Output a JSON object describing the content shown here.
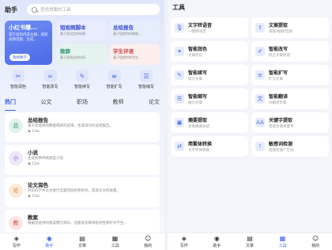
{
  "left": {
    "title": "助手",
    "search_placeholder": "查找想要的工具",
    "hero": {
      "big": {
        "title": "小红书爆...",
        "desc": "基于您的内容主题，提取高频话题，生成...",
        "button": "我想教学"
      },
      "cards": [
        {
          "title": "短视频脚本",
          "desc": "基于您设定的场景..."
        },
        {
          "title": "总结报告",
          "desc": "基于您提供的数据..."
        },
        {
          "title": "致辞",
          "desc": "基于您给出的时间..."
        },
        {
          "title": "学生评语",
          "desc": "基于您提供的学生..."
        }
      ]
    },
    "quick_tools": [
      {
        "icon": "scissors-icon",
        "glyph": "✂",
        "label": "智能润色"
      },
      {
        "icon": "link-icon",
        "glyph": "∞",
        "label": "智能改写"
      },
      {
        "icon": "pen-icon",
        "glyph": "✎",
        "label": "智能续写"
      },
      {
        "icon": "list-icon",
        "glyph": "≡",
        "label": "智能扩写"
      },
      {
        "icon": "compress-icon",
        "glyph": "☰",
        "label": "智能缩写"
      }
    ],
    "tabs": [
      "热门",
      "公文",
      "职场",
      "教师",
      "论文"
    ],
    "active_tab": 0,
    "items": [
      {
        "avatar": "总",
        "color": "#dff1ee",
        "fg": "#2a8f6a",
        "title": "总结报告",
        "desc": "基于您提供的数据或研究成果，生成详尽的总结报告。",
        "count": "13w"
      },
      {
        "avatar": "小",
        "color": "#efe6fb",
        "fg": "#7a4fd0",
        "title": "小说",
        "desc": "生成各种风格类型小说",
        "count": "12w"
      },
      {
        "avatar": "论",
        "color": "#fdebd9",
        "fg": "#d27a1e",
        "title": "论文润色",
        "desc": "对您的学术论文进行全面的润色和校对，提高论文的质量。",
        "count": "10w"
      },
      {
        "avatar": "教",
        "color": "#fde4e4",
        "fg": "#cc4a4a",
        "title": "教案",
        "desc": "根据您提供的教案撰写目标，创建具有教师指导性和针对学生...",
        "count": ""
      }
    ],
    "nav": [
      {
        "icon": "home-icon",
        "glyph": "◈",
        "label": "写作"
      },
      {
        "icon": "assistant-icon",
        "glyph": "◉",
        "label": "助手"
      },
      {
        "icon": "document-icon",
        "glyph": "▤",
        "label": "文章"
      },
      {
        "icon": "tools-icon",
        "glyph": "▦",
        "label": "工具"
      },
      {
        "icon": "user-icon",
        "glyph": "☺",
        "label": "我的"
      }
    ],
    "nav_active": 1
  },
  "right": {
    "title": "工具",
    "tools": [
      {
        "icon": "mic-icon",
        "glyph": "🎙",
        "bg": "#e6ecfc",
        "title": "文字转语音",
        "desc": "一键转语音"
      },
      {
        "icon": "extract-icon",
        "glyph": "⇪",
        "bg": "#e6ecfc",
        "title": "文案提取",
        "desc": "链接/视频/音频"
      },
      {
        "icon": "polish-icon",
        "glyph": "✦",
        "bg": "#e6ecfc",
        "title": "智能润色",
        "desc": "文章优化"
      },
      {
        "icon": "rewrite-icon",
        "glyph": "✐",
        "bg": "#e6ecfc",
        "title": "智能改写",
        "desc": "修正文章原意"
      },
      {
        "icon": "continue-icon",
        "glyph": "✎",
        "bg": "#e6ecfc",
        "title": "智能续写",
        "desc": "续写文章"
      },
      {
        "icon": "expand-icon",
        "glyph": "≡",
        "bg": "#e6ecfc",
        "title": "智能扩写",
        "desc": "扩写文章"
      },
      {
        "icon": "shrink-icon",
        "glyph": "☰",
        "bg": "#e6ecfc",
        "title": "智能缩写",
        "desc": "缩写文章"
      },
      {
        "icon": "translate-icon",
        "glyph": "文",
        "bg": "#e6ecfc",
        "title": "智能翻译",
        "desc": "AI翻译文章"
      },
      {
        "icon": "summary-icon",
        "glyph": "▣",
        "bg": "#e6ecfc",
        "title": "摘要提取",
        "desc": "文章摘要总结"
      },
      {
        "icon": "keyword-icon",
        "glyph": "AA",
        "bg": "#e6ecfc",
        "title": "关键字提取",
        "desc": "提取文章关键字"
      },
      {
        "icon": "convert-icon",
        "glyph": "⇄",
        "bg": "#e6ecfc",
        "title": "简繁体转换",
        "desc": "文字字体转换"
      },
      {
        "icon": "sensitive-icon",
        "glyph": "!",
        "bg": "#e6ecfc",
        "title": "敏感词检测",
        "desc": "智能检测广告词"
      }
    ],
    "nav": [
      {
        "icon": "home-icon",
        "glyph": "◈",
        "label": "写作"
      },
      {
        "icon": "assistant-icon",
        "glyph": "◉",
        "label": "助手"
      },
      {
        "icon": "document-icon",
        "glyph": "▤",
        "label": "文章"
      },
      {
        "icon": "tools-icon",
        "glyph": "▦",
        "label": "工具"
      },
      {
        "icon": "user-icon",
        "glyph": "☺",
        "label": "我的"
      }
    ],
    "nav_active": 3
  }
}
